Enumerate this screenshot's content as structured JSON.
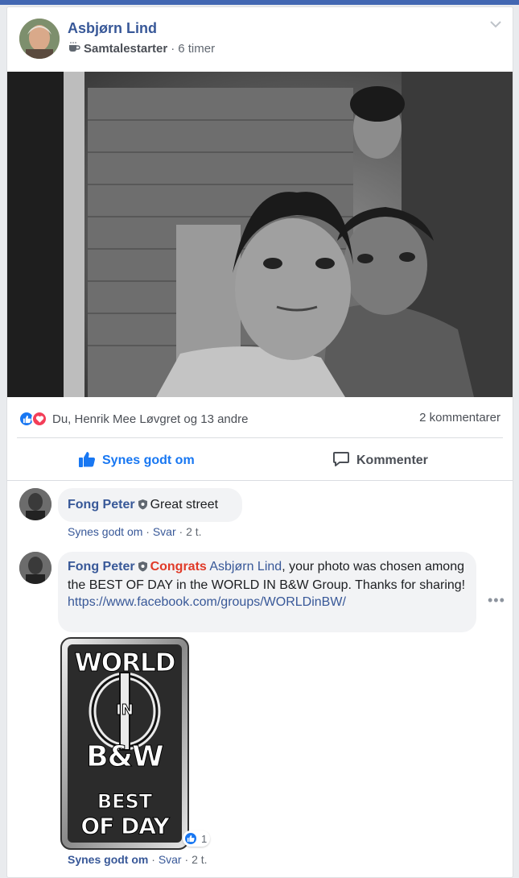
{
  "post": {
    "author": "Asbjørn Lind",
    "badge_label": "Samtalestarter",
    "separator": "·",
    "time": "6 timer",
    "photo_alt": "Two children portrait",
    "reactions_text": "Du, Henrik Mee Løvgret og 13 andre",
    "comments_count": "2 kommentarer",
    "like_label": "Synes godt om",
    "comment_label": "Kommenter"
  },
  "comments": [
    {
      "author": "Fong Peter",
      "text": "Great street",
      "like_label": "Synes godt om",
      "reply_label": "Svar",
      "time": "2 t."
    },
    {
      "author": "Fong Peter",
      "congrats": "Congrats",
      "mention": "Asbjørn Lind",
      "text_rest": ", your photo was chosen among the BEST OF DAY in the WORLD IN B&W Group. Thanks for sharing!",
      "link": "https://www.facebook.com/groups/WORLDinBW/",
      "like_label": "Synes godt om",
      "reply_label": "Svar",
      "time": "2 t.",
      "like_count": "1",
      "badge_image": {
        "line1": "WORLD",
        "line2": "IN",
        "line3": "B&W",
        "line4": "BEST",
        "line5": "OF DAY"
      }
    }
  ],
  "colors": {
    "brand_blue": "#4267b2",
    "link_blue": "#385898",
    "like_blue": "#1877f2",
    "congrats_red": "#e03a28",
    "love_red": "#f33e58"
  },
  "icons": [
    "chevron-down-icon",
    "coffee-icon",
    "like-reaction-icon",
    "love-reaction-icon",
    "thumbs-up-icon",
    "comment-icon",
    "shield-badge-icon",
    "more-options-icon"
  ]
}
